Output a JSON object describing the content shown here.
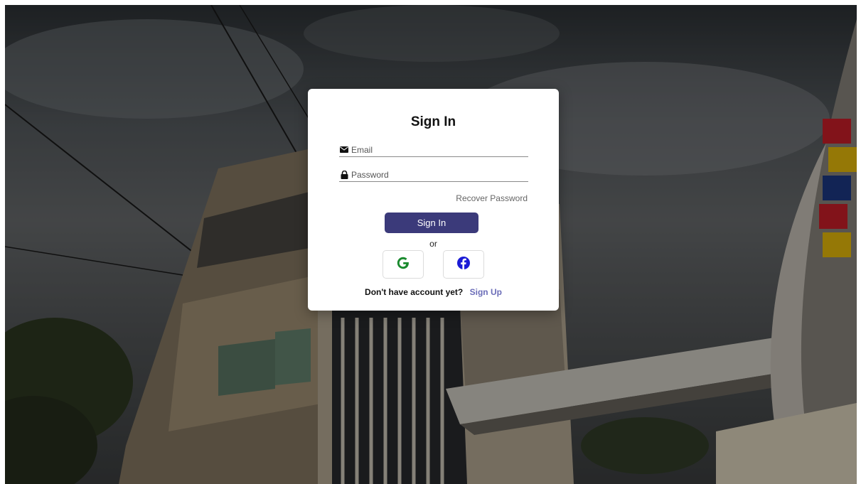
{
  "login": {
    "title": "Sign In",
    "email_placeholder": "Email",
    "password_placeholder": "Password",
    "recover_label": "Recover Password",
    "signin_label": "Sign In",
    "or_label": "or",
    "no_account_text": "Don't have account yet?",
    "signup_label": "Sign Up"
  },
  "icons": {
    "email": "envelope-icon",
    "password": "lock-icon",
    "google": "google-icon",
    "facebook": "facebook-icon"
  },
  "colors": {
    "primary_button": "#3b3a7a",
    "link": "#6b6db8",
    "google": "#1a8a2e",
    "facebook": "#1b1bd6"
  }
}
